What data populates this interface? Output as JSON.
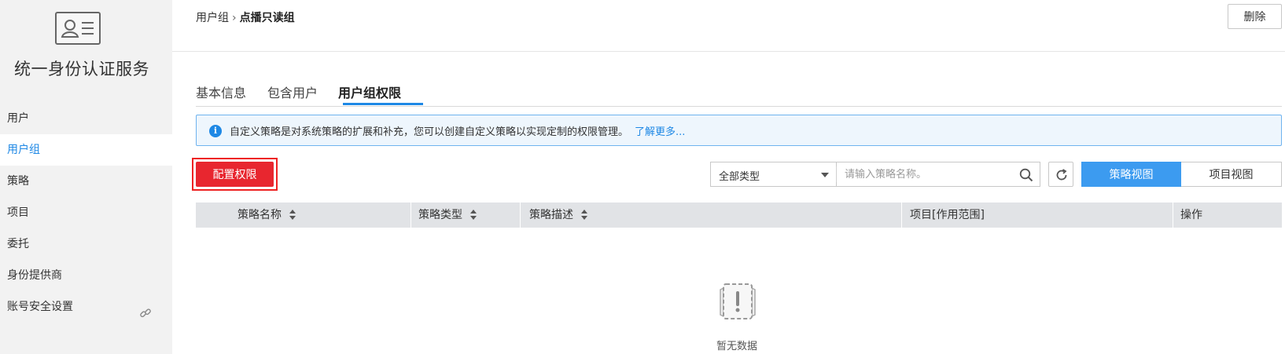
{
  "sidebar": {
    "logo_icon": "id-card-icon",
    "title": "统一身份认证服务",
    "items": [
      {
        "label": "用户",
        "active": false
      },
      {
        "label": "用户组",
        "active": true
      },
      {
        "label": "策略",
        "active": false
      },
      {
        "label": "项目",
        "active": false
      },
      {
        "label": "委托",
        "active": false
      },
      {
        "label": "身份提供商",
        "active": false
      },
      {
        "label": "账号安全设置",
        "active": false,
        "icon": "link-icon"
      }
    ]
  },
  "header": {
    "breadcrumb_parent": "用户组",
    "breadcrumb_sep": "›",
    "breadcrumb_current": "点播只读组",
    "delete_label": "删除"
  },
  "tabs": [
    {
      "label": "基本信息",
      "active": false
    },
    {
      "label": "包含用户",
      "active": false
    },
    {
      "label": "用户组权限",
      "active": true
    }
  ],
  "info": {
    "icon": "info-icon",
    "text": "自定义策略是对系统策略的扩展和补充，您可以创建自定义策略以实现定制的权限管理。",
    "link": "了解更多..."
  },
  "toolbar": {
    "config_label": "配置权限",
    "type_select_value": "全部类型",
    "search_placeholder": "请输入策略名称。",
    "view_policy_label": "策略视图",
    "view_project_label": "项目视图"
  },
  "table": {
    "columns": [
      "策略名称",
      "策略类型",
      "策略描述",
      "项目[作用范围]",
      "操作"
    ],
    "rows": [],
    "empty_text": "暂无数据"
  },
  "colors": {
    "accent": "#1e88e5",
    "primary_button": "#e8262f",
    "active_view": "#3c9bf0"
  }
}
